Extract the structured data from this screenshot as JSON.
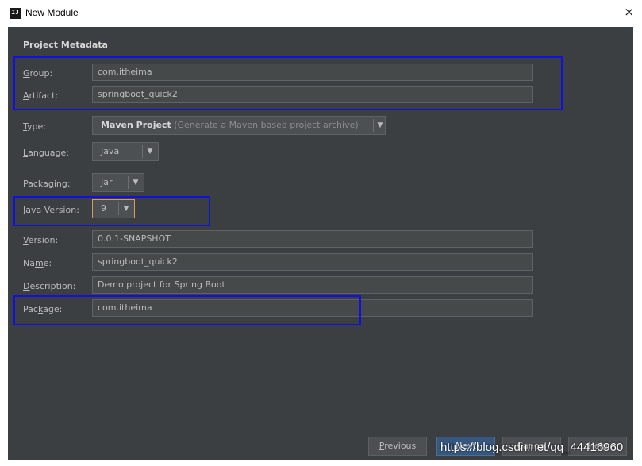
{
  "window": {
    "title": "New Module",
    "close_glyph": "×",
    "app_icon_text": "IJ"
  },
  "section_title": "Project Metadata",
  "fields": {
    "group": {
      "label_pre": "",
      "label_mn": "G",
      "label_post": "roup:",
      "value": "com.itheima"
    },
    "artifact": {
      "label_pre": "",
      "label_mn": "A",
      "label_post": "rtifact:",
      "value": "springboot_quick2"
    },
    "type": {
      "label_pre": "",
      "label_mn": "T",
      "label_post": "ype:",
      "value": "Maven Project",
      "hint": "(Generate a Maven based project archive)"
    },
    "language": {
      "label_pre": "",
      "label_mn": "L",
      "label_post": "anguage:",
      "value": "Java"
    },
    "packaging": {
      "label_pre": "Packa",
      "label_mn": "g",
      "label_post": "ing:",
      "value": "Jar"
    },
    "java_version": {
      "label_pre": "",
      "label_mn": "J",
      "label_post": "ava Version:",
      "value": "9"
    },
    "version": {
      "label_pre": "",
      "label_mn": "V",
      "label_post": "ersion:",
      "value": "0.0.1-SNAPSHOT"
    },
    "name": {
      "label_pre": "Na",
      "label_mn": "m",
      "label_post": "e:",
      "value": "springboot_quick2"
    },
    "description": {
      "label_pre": "",
      "label_mn": "D",
      "label_post": "escription:",
      "value": "Demo project for Spring Boot"
    },
    "package": {
      "label_pre": "Pac",
      "label_mn": "k",
      "label_post": "age:",
      "value": "com.itheima"
    }
  },
  "dropdown_arrow": "▼",
  "buttons": {
    "previous": {
      "pre": "",
      "mn": "P",
      "post": "revious"
    },
    "next": "Next",
    "cancel": "Cancel",
    "help": "Help"
  },
  "watermark": "https://blog.csdn.net/qq_44416960",
  "colors": {
    "dialog_bg": "#3c3f41",
    "field_bg": "#45494a",
    "annotation": "#1010e0",
    "focus": "#d49e56"
  }
}
